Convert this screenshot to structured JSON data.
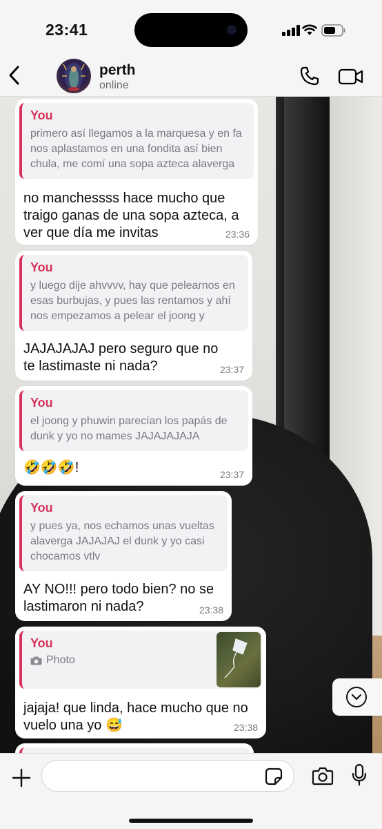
{
  "status_bar": {
    "time": "23:41"
  },
  "header": {
    "name": "perth",
    "status": "online"
  },
  "messages": [
    {
      "quote_author": "You",
      "quote_text": "primero así llegamos a la marquesa y en fa nos aplastamos en una fondita así bien chula, me comí una sopa azteca alaverga",
      "text": "no manchessss hace mucho que traigo ganas de una sopa azteca, a ver que día me invitas",
      "time": "23:36"
    },
    {
      "quote_author": "You",
      "quote_text": "y luego dije ahvvvv, hay que pelearnos en esas burbujas, y pues las rentamos y ahí nos empezamos a pelear el joong y",
      "text": "JAJAJAJAJ pero seguro que no te lastimaste ni nada?",
      "time": "23:37"
    },
    {
      "quote_author": "You",
      "quote_text": "el joong y phuwin parecían los papás de dunk y yo no mames JAJAJAJAJA",
      "text": "🤣🤣🤣!",
      "time": "23:37"
    },
    {
      "quote_author": "You",
      "quote_text": "y pues ya, nos echamos unas vueltas alaverga JAJAJAJ el dunk y yo casi chocamos vtlv",
      "text": "AY NO!!! pero todo bien? no se lastimaron ni nada?",
      "time": "23:38"
    },
    {
      "quote_author": "You",
      "quote_text": "Photo",
      "text": "jajaja! que linda, hace mucho que no vuelo una yo 😅",
      "time": "23:38"
    }
  ],
  "input": {
    "value": "",
    "placeholder": ""
  },
  "colors": {
    "accent": "#d6345a",
    "bubble": "#ffffff",
    "quote_bg": "#f2f2f4",
    "bar_bg": "#f5f5f5"
  }
}
